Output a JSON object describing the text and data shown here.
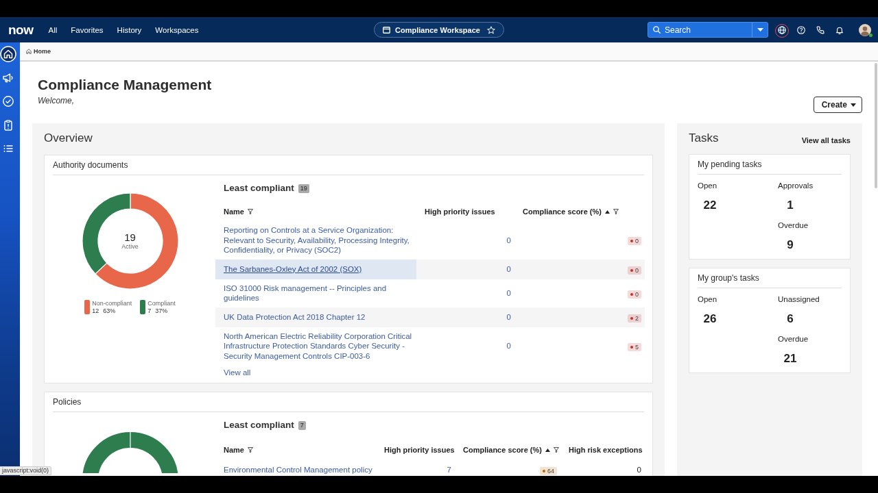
{
  "nav": {
    "logo": "now",
    "links": [
      {
        "label": "All"
      },
      {
        "label": "Favorites"
      },
      {
        "label": "History"
      },
      {
        "label": "Workspaces"
      }
    ],
    "workspace": {
      "label": "Compliance Workspace",
      "favorite": false
    },
    "search": {
      "placeholder": "Search"
    },
    "globe_highlighted": true,
    "user": {
      "online": true
    }
  },
  "sidebar": {
    "items": [
      {
        "kind": "home",
        "selected": true
      },
      {
        "kind": "megaphone",
        "selected": false
      },
      {
        "kind": "check",
        "selected": false
      },
      {
        "kind": "clipboard",
        "selected": false
      },
      {
        "kind": "list",
        "selected": false
      }
    ]
  },
  "breadcrumb": {
    "label": "Home"
  },
  "header": {
    "title": "Compliance Management",
    "subtitle": "Welcome,",
    "create_button": "Create"
  },
  "overview": {
    "title": "Overview",
    "cards": [
      {
        "title": "Authority documents",
        "chart": {
          "kind": "donut",
          "center_value": "19",
          "center_label": "Active",
          "chart_data": {
            "type": "donut",
            "categories": [
              "Non-compliant",
              "Compliant"
            ],
            "values": [
              63,
              37
            ]
          },
          "legend": [
            {
              "count": "12",
              "percent": "63%",
              "color": "#e8664a"
            },
            {
              "count": "7",
              "percent": "37%",
              "color": "#2e7d4f"
            }
          ]
        },
        "table": {
          "title": "Least compliant",
          "count": "19",
          "columns": [
            {
              "label": "Name",
              "filter": true,
              "sort_ascending": false
            },
            {
              "label": "High priority issues",
              "filter": false,
              "sort_ascending": false
            },
            {
              "label": "Compliance score (%)",
              "filter": true,
              "sort_ascending": true
            }
          ],
          "rows": [
            {
              "hovered": false,
              "cells": [
                {
                  "kind": "link",
                  "text": "Reporting on Controls at a Service Organization: Relevant to Security, Availability, Processing Integrity, Confidentiality, or Privacy (SOC2)"
                },
                {
                  "kind": "link-number",
                  "text": "0"
                },
                {
                  "kind": "badge",
                  "text": "0",
                  "color": "#c9302c"
                }
              ]
            },
            {
              "hovered": true,
              "cells": [
                {
                  "kind": "link",
                  "text": "The Sarbanes-Oxley Act of 2002 (SOX)"
                },
                {
                  "kind": "link-number",
                  "text": "0"
                },
                {
                  "kind": "badge",
                  "text": "0",
                  "color": "#c9302c"
                }
              ]
            },
            {
              "hovered": false,
              "cells": [
                {
                  "kind": "link",
                  "text": "ISO 31000 Risk management -- Principles and guidelines"
                },
                {
                  "kind": "link-number",
                  "text": "0"
                },
                {
                  "kind": "badge",
                  "text": "0",
                  "color": "#c9302c"
                }
              ]
            },
            {
              "hovered": false,
              "cells": [
                {
                  "kind": "link",
                  "text": "UK Data Protection Act 2018 Chapter 12"
                },
                {
                  "kind": "link-number",
                  "text": "0"
                },
                {
                  "kind": "badge",
                  "text": "2",
                  "color": "#c9302c"
                }
              ]
            },
            {
              "hovered": false,
              "cells": [
                {
                  "kind": "link",
                  "text": "North American Electric Reliability Corporation Critical Infrastructure Protection Standards Cyber Security - Security Management Controls CIP-003-6"
                },
                {
                  "kind": "link-number",
                  "text": "0"
                },
                {
                  "kind": "badge",
                  "text": "5",
                  "color": "#c9302c"
                }
              ]
            }
          ],
          "footer_link": "View all"
        }
      },
      {
        "title": "Policies",
        "chart": {
          "kind": "ring"
        },
        "table": {
          "title": "Least compliant",
          "count": "7",
          "columns": [
            {
              "label": "Name",
              "filter": true,
              "sort_ascending": false
            },
            {
              "label": "High priority issues",
              "filter": false,
              "sort_ascending": false
            },
            {
              "label": "Compliance score (%)",
              "filter": true,
              "sort_ascending": true
            },
            {
              "label": "High risk exceptions",
              "filter": false,
              "sort_ascending": false
            }
          ],
          "rows": [
            {
              "hovered": false,
              "cells": [
                {
                  "kind": "link",
                  "text": "Environmental Control Management policy"
                },
                {
                  "kind": "link-number",
                  "text": "7"
                },
                {
                  "kind": "badge",
                  "text": "64",
                  "color": "#b86a00"
                },
                {
                  "kind": "number",
                  "text": "0"
                }
              ]
            }
          ]
        }
      }
    ]
  },
  "tasks": {
    "title": "Tasks",
    "view_all": "View all tasks",
    "cards": [
      {
        "title": "My pending tasks",
        "columns": [
          [
            {
              "label": "Open",
              "value": "22"
            }
          ],
          [
            {
              "label": "Approvals",
              "value": "1"
            },
            {
              "label": "Overdue",
              "value": "9"
            }
          ]
        ]
      },
      {
        "title": "My group's tasks",
        "columns": [
          [
            {
              "label": "Open",
              "value": "26"
            }
          ],
          [
            {
              "label": "Unassigned",
              "value": "6"
            },
            {
              "label": "Overdue",
              "value": "21"
            }
          ]
        ]
      }
    ]
  },
  "status_bar": {
    "url": "javascript:void(0)"
  }
}
